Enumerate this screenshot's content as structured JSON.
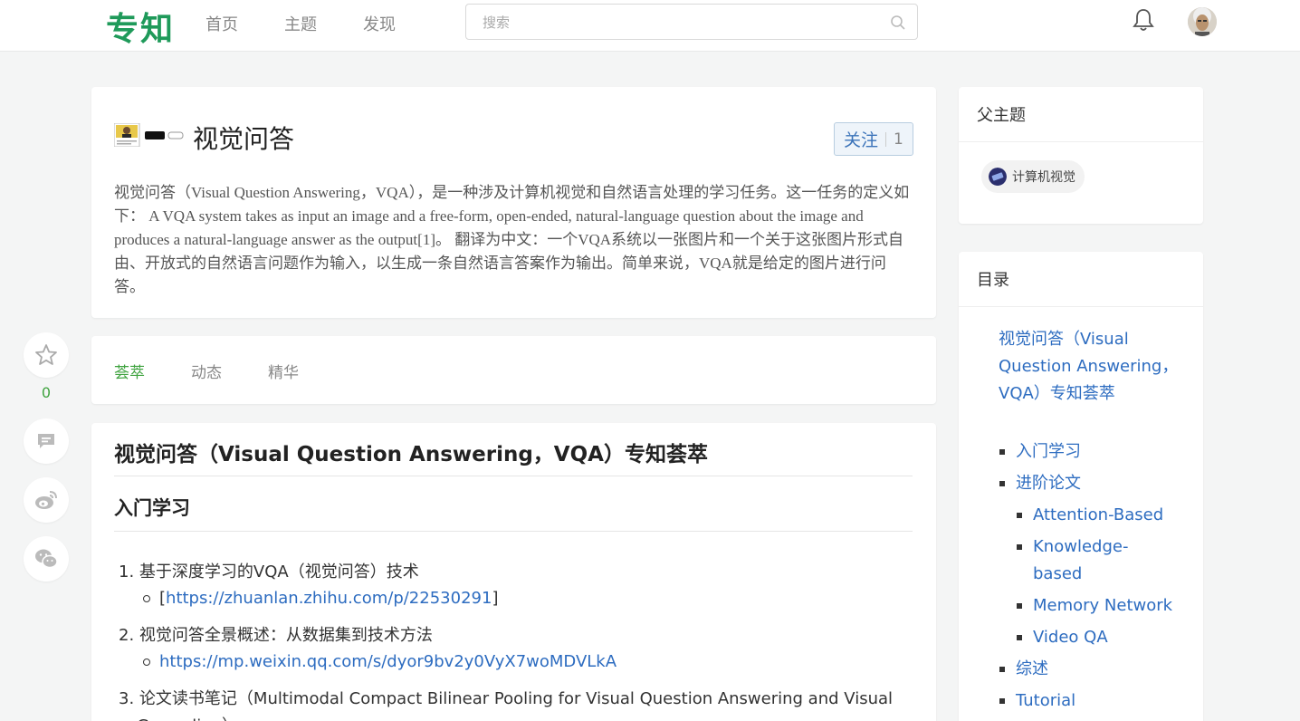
{
  "header": {
    "logo": "专知",
    "nav": [
      "首页",
      "主题",
      "发现"
    ],
    "search_placeholder": "搜索",
    "colors": {
      "brand": "#1f9a5a",
      "link": "#2d6cc0",
      "accent_green": "#3fa33f"
    }
  },
  "topic": {
    "title": "视觉问答",
    "follow_label": "关注",
    "follow_count": "1",
    "description": "视觉问答（Visual Question Answering，VQA），是一种涉及计算机视觉和自然语言处理的学习任务。这一任务的定义如下： A VQA system takes as input an image and a free-form, open-ended, natural-language question about the image and produces a natural-language answer as the output[1]。 翻译为中文：一个VQA系统以一张图片和一个关于这张图片形式自由、开放式的自然语言问题作为输入，以生成一条自然语言答案作为输出。简单来说，VQA就是给定的图片进行问答。"
  },
  "tabs": [
    {
      "label": "荟萃",
      "active": true
    },
    {
      "label": "动态",
      "active": false
    },
    {
      "label": "精华",
      "active": false
    }
  ],
  "floating": {
    "star_count": "0"
  },
  "content": {
    "h1": "视觉问答（Visual Question Answering，VQA）专知荟萃",
    "h2": "入门学习",
    "items": [
      {
        "num": "1.",
        "text": "基于深度学习的VQA（视觉问答）技术",
        "sub_pre": "[",
        "sub_link": "https://zhuanlan.zhihu.com/p/22530291",
        "sub_post": "]"
      },
      {
        "num": "2.",
        "text": "视觉问答全景概述：从数据集到技术方法",
        "sub_link": "https://mp.weixin.qq.com/s/dyor9bv2y0VyX7woMDVLkA"
      },
      {
        "num": "3.",
        "text": "论文读书笔记（Multimodal Compact Bilinear Pooling for Visual Question Answering and Visual",
        "text_cont": "Grounding）"
      }
    ]
  },
  "sidebar": {
    "parent_title": "父主题",
    "parent_chip": "计算机视觉",
    "toc_title": "目录",
    "toc_top": "视觉问答（Visual Question Answering，VQA）专知荟萃",
    "toc_level1": [
      "入门学习",
      "进阶论文",
      "综述",
      "Tutorial"
    ],
    "toc_level2": [
      "Attention-Based",
      "Knowledge-based",
      "Memory Network",
      "Video QA"
    ]
  }
}
